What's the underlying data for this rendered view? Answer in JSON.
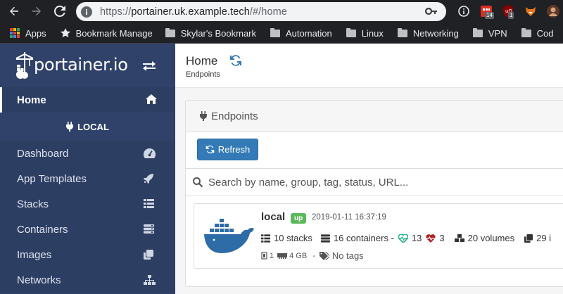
{
  "browser": {
    "url_prefix": "https://",
    "url_host": "portainer.uk.example.tech",
    "url_path": "/#/home",
    "ext_badge_1": "14",
    "ext_badge_2": "1",
    "bookmarks": [
      {
        "label": "Apps",
        "icon": "apps-grid-icon"
      },
      {
        "label": "Bookmark Manage",
        "icon": "star-icon"
      },
      {
        "label": "Skylar's Bookmark",
        "icon": "folder-icon"
      },
      {
        "label": "Automation",
        "icon": "folder-icon"
      },
      {
        "label": "Linux",
        "icon": "folder-icon"
      },
      {
        "label": "Networking",
        "icon": "folder-icon"
      },
      {
        "label": "VPN",
        "icon": "folder-icon"
      },
      {
        "label": "Cod",
        "icon": "folder-icon"
      }
    ]
  },
  "sidebar": {
    "logo_text": "portainer.io",
    "home_label": "Home",
    "endpoint_label": "LOCAL",
    "items": [
      {
        "label": "Dashboard",
        "icon": "tachometer-icon"
      },
      {
        "label": "App Templates",
        "icon": "rocket-icon"
      },
      {
        "label": "Stacks",
        "icon": "list-icon"
      },
      {
        "label": "Containers",
        "icon": "server-icon"
      },
      {
        "label": "Images",
        "icon": "clone-icon"
      },
      {
        "label": "Networks",
        "icon": "sitemap-icon"
      }
    ]
  },
  "header": {
    "title": "Home",
    "subtitle": "Endpoints"
  },
  "panel": {
    "title": "Endpoints",
    "refresh_label": "Refresh",
    "search_placeholder": "Search by name, group, tag, status, URL..."
  },
  "endpoint": {
    "name": "local",
    "status": "up",
    "date": "2019-01-11 16:37:19",
    "stacks": "10 stacks",
    "containers": "16 containers -",
    "healthy": "13",
    "unhealthy": "3",
    "volumes": "20 volumes",
    "images_partial": "29 i",
    "cpu": "1",
    "memory": "4 GB",
    "sep": "-",
    "tags": "No tags"
  },
  "colors": {
    "sidebar_bg": "#30426a",
    "accent_blue": "#337ab7",
    "status_up": "#5cb85c",
    "docker_blue": "#2e6ca7",
    "healthy": "#23ae89",
    "unhealthy": "#ae2323"
  }
}
